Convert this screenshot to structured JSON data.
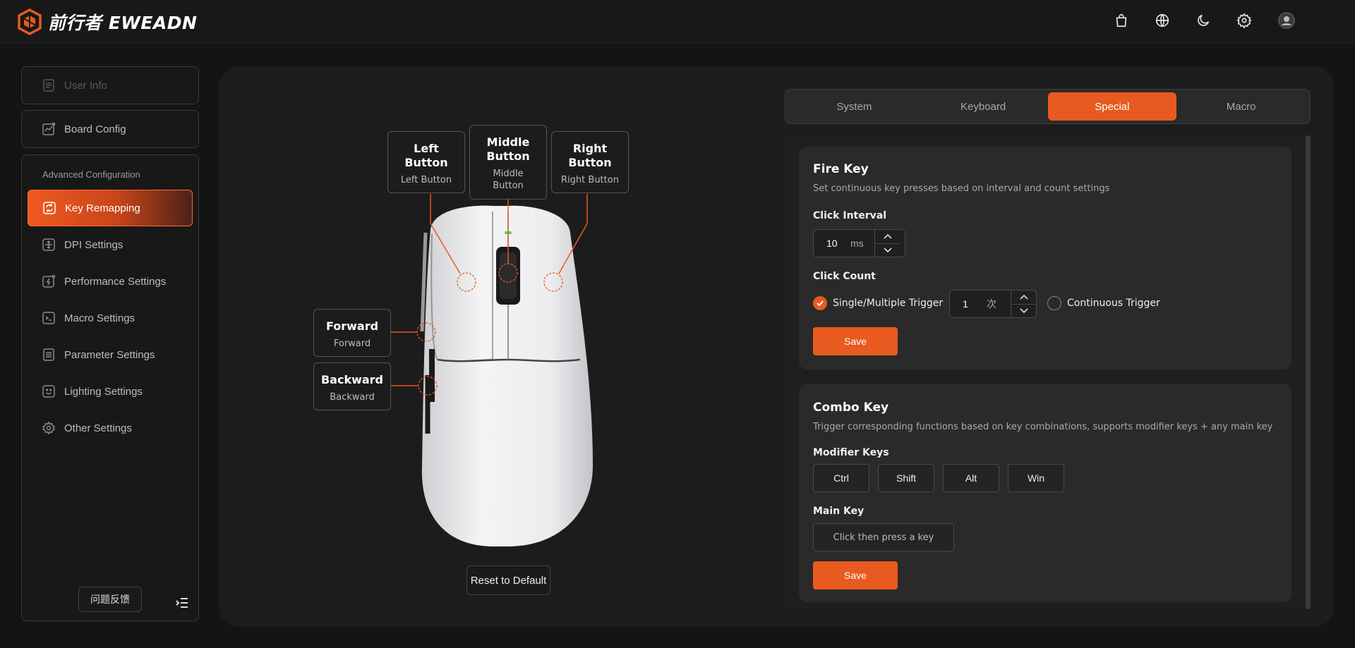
{
  "brand": {
    "name": "前行者 EWEADN"
  },
  "header": {
    "icons": [
      "shopping-bag-icon",
      "globe-icon",
      "moon-icon",
      "gear-icon",
      "user-avatar-icon"
    ]
  },
  "sidebar": {
    "user_info": "User Info",
    "board_config": "Board Config",
    "advanced_label": "Advanced Configuration",
    "items": [
      {
        "label": "Key Remapping",
        "icon": "refresh-square-icon",
        "active": true
      },
      {
        "label": "DPI Settings",
        "icon": "dpi-icon"
      },
      {
        "label": "Performance Settings",
        "icon": "lightning-icon"
      },
      {
        "label": "Macro Settings",
        "icon": "terminal-icon"
      },
      {
        "label": "Parameter Settings",
        "icon": "list-icon"
      },
      {
        "label": "Lighting Settings",
        "icon": "smile-icon"
      },
      {
        "label": "Other Settings",
        "icon": "gear-icon"
      }
    ],
    "feedback": "问题反馈"
  },
  "mouse": {
    "left": {
      "title_1": "Left",
      "title_2": "Button",
      "sub": "Left Button"
    },
    "middle": {
      "title_1": "Middle",
      "title_2": "Button",
      "sub_1": "Middle",
      "sub_2": "Button"
    },
    "right": {
      "title_1": "Right",
      "title_2": "Button",
      "sub": "Right Button"
    },
    "forward": {
      "title": "Forward",
      "sub": "Forward"
    },
    "backward": {
      "title": "Backward",
      "sub": "Backward"
    },
    "reset": "Reset to Default"
  },
  "tabs": [
    {
      "label": "System"
    },
    {
      "label": "Keyboard"
    },
    {
      "label": "Special",
      "active": true
    },
    {
      "label": "Macro"
    }
  ],
  "fire_key": {
    "title": "Fire Key",
    "desc": "Set continuous key presses based on interval and count settings",
    "interval_label": "Click Interval",
    "interval_value": "10",
    "interval_unit": "ms",
    "count_label": "Click Count",
    "single_label": "Single/Multiple Trigger",
    "count_value": "1",
    "count_unit": "次",
    "continuous_label": "Continuous Trigger",
    "save": "Save"
  },
  "combo_key": {
    "title": "Combo Key",
    "desc": "Trigger corresponding functions based on key combinations, supports modifier keys + any main key",
    "modifier_label": "Modifier Keys",
    "modifiers": [
      "Ctrl",
      "Shift",
      "Alt",
      "Win"
    ],
    "main_key_label": "Main Key",
    "main_key_placeholder": "Click then press a key",
    "save": "Save"
  },
  "colors": {
    "accent": "#e85a1f",
    "bg": "#141414",
    "panel": "#1c1c1c",
    "card": "#2a2a2a"
  }
}
